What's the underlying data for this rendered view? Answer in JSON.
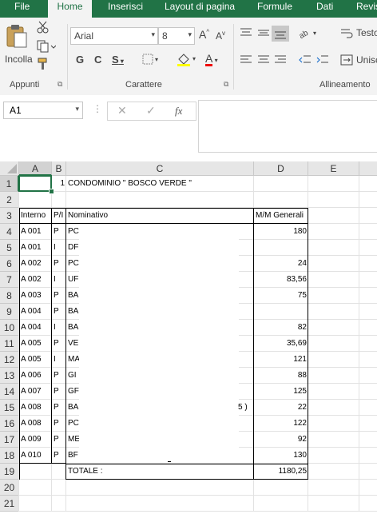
{
  "tabs": [
    "File",
    "Home",
    "Inserisci",
    "Layout di pagina",
    "Formule",
    "Dati",
    "Revis"
  ],
  "active_tab": "Home",
  "ribbon": {
    "paste_label": "Incolla",
    "group_clipboard": "Appunti",
    "font_name": "Arial",
    "font_size": "8",
    "bold": "G",
    "italic": "C",
    "underline": "S",
    "grow_font": "A",
    "shrink_font": "A",
    "font_color_letter": "A",
    "group_font": "Carattere",
    "wrap_text": "Testo",
    "merge": "Unisci",
    "group_align": "Allineamento"
  },
  "formula_bar": {
    "name_box": "A1",
    "fx": "fx",
    "formula": ""
  },
  "columns": [
    "A",
    "B",
    "C",
    "D",
    "E"
  ],
  "rows": [
    "1",
    "2",
    "3",
    "4",
    "5",
    "6",
    "7",
    "8",
    "9",
    "10",
    "11",
    "12",
    "13",
    "14",
    "15",
    "16",
    "17",
    "18",
    "19",
    "20",
    "21"
  ],
  "cells": {
    "b1": "1",
    "c1": "CONDOMINIO \" BOSCO VERDE \"",
    "headers": {
      "interno": "Interno",
      "pi": "P/I",
      "nominativo": "Nominativo",
      "mm": "M/M Generali"
    },
    "data": [
      {
        "interno": "A 001",
        "pi": "P",
        "nom": "PC",
        "mm": "180"
      },
      {
        "interno": "A 001",
        "pi": "I",
        "nom": "DF",
        "mm": ""
      },
      {
        "interno": "A 002",
        "pi": "P",
        "nom": "PC",
        "mm": "24"
      },
      {
        "interno": "A 002",
        "pi": "I",
        "nom": "UF",
        "mm": "83,56"
      },
      {
        "interno": "A 003",
        "pi": "P",
        "nom": "BA",
        "mm": "75"
      },
      {
        "interno": "A 004",
        "pi": "P",
        "nom": "BA",
        "mm": ""
      },
      {
        "interno": "A 004",
        "pi": "I",
        "nom": "BA",
        "mm": "82"
      },
      {
        "interno": "A 005",
        "pi": "P",
        "nom": "VE",
        "mm": "35,69"
      },
      {
        "interno": "A 005",
        "pi": "I",
        "nom": "MA",
        "mm": "121"
      },
      {
        "interno": "A 006",
        "pi": "P",
        "nom": "GI",
        "mm": "88"
      },
      {
        "interno": "A 007",
        "pi": "P",
        "nom": "GF",
        "mm": "125"
      },
      {
        "interno": "A 008",
        "pi": "P",
        "nom": "BA",
        "mm": "22"
      },
      {
        "interno": "A 008",
        "pi": "P",
        "nom": "PC",
        "mm": "122"
      },
      {
        "interno": "A 009",
        "pi": "P",
        "nom": "ME",
        "mm": "92"
      },
      {
        "interno": "A 010",
        "pi": "P",
        "nom": "BF",
        "mm": "130"
      }
    ],
    "totale_label": "TOTALE :",
    "totale_value": "1180,25",
    "row15_tail": "5 )"
  },
  "colors": {
    "excel_green": "#217346",
    "ribbon_bg": "#f3f3f3",
    "header_bg": "#e6e6e6"
  }
}
